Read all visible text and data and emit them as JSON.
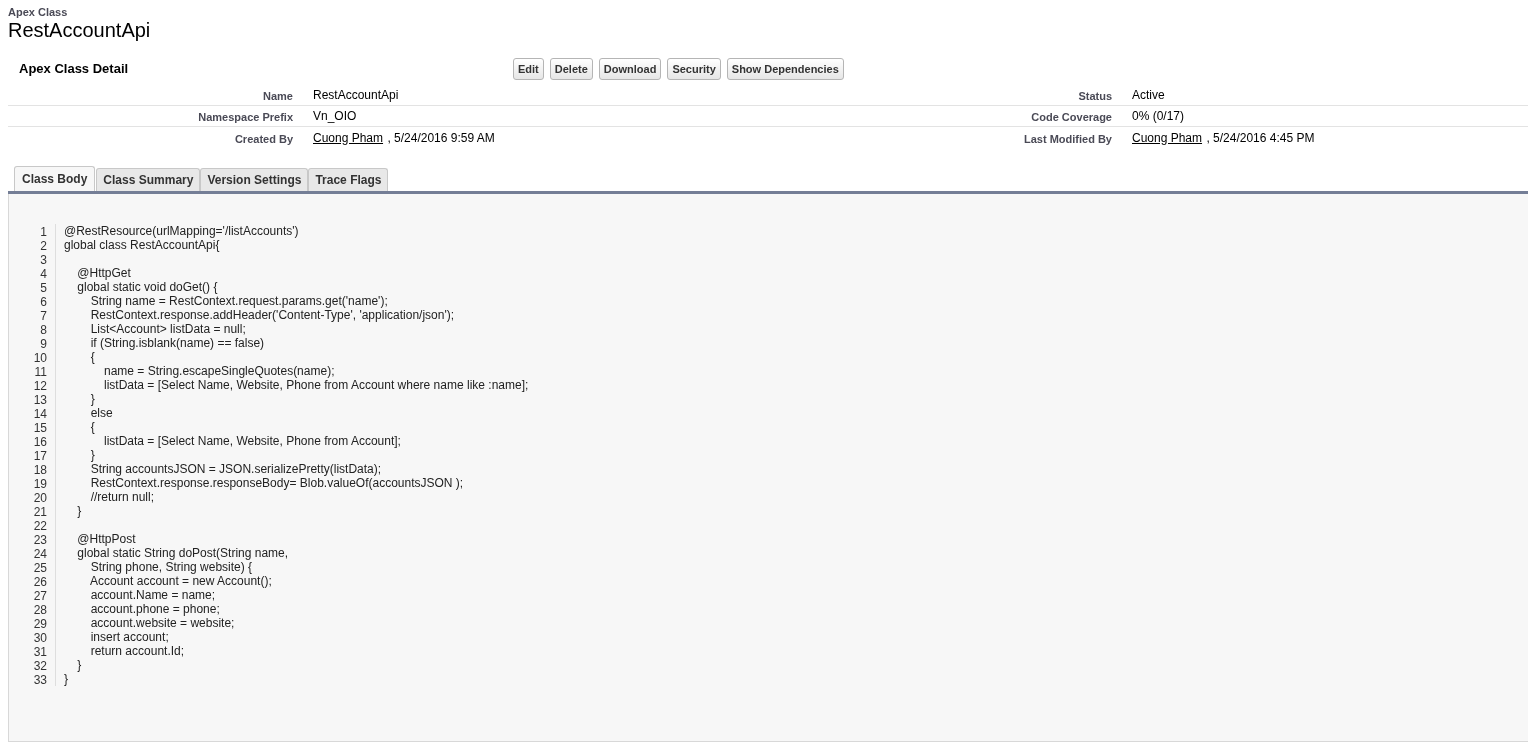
{
  "header": {
    "object_type": "Apex Class",
    "title": "RestAccountApi"
  },
  "detail": {
    "heading": "Apex Class Detail",
    "buttons": [
      "Edit",
      "Delete",
      "Download",
      "Security",
      "Show Dependencies"
    ],
    "rows": [
      {
        "left": {
          "label": "Name",
          "kind": "text",
          "value": "RestAccountApi"
        },
        "right": {
          "label": "Status",
          "kind": "text",
          "value": "Active"
        }
      },
      {
        "left": {
          "label": "Namespace Prefix",
          "kind": "text",
          "value": "Vn_OIO"
        },
        "right": {
          "label": "Code Coverage",
          "kind": "text",
          "value": "0% (0/17)"
        }
      },
      {
        "left": {
          "label": "Created By",
          "kind": "user",
          "user": "Cuong Pham",
          "date": ", 5/24/2016 9:59 AM"
        },
        "right": {
          "label": "Last Modified By",
          "kind": "user",
          "user": "Cuong Pham",
          "date": ", 5/24/2016 4:45 PM"
        }
      }
    ]
  },
  "tabs": [
    {
      "label": "Class Body",
      "selected": true
    },
    {
      "label": "Class Summary",
      "selected": false
    },
    {
      "label": "Version Settings",
      "selected": false
    },
    {
      "label": "Trace Flags",
      "selected": false
    }
  ],
  "code": [
    {
      "number": "1",
      "text": "@RestResource(urlMapping='/listAccounts')"
    },
    {
      "number": "2",
      "text": "global class RestAccountApi{"
    },
    {
      "number": "3"
    },
    {
      "number": "4",
      "text": "    @HttpGet"
    },
    {
      "number": "5",
      "text": "    global static void doGet() {"
    },
    {
      "number": "6",
      "text": "        String name = RestContext.request.params.get('name');"
    },
    {
      "number": "7",
      "text": "        RestContext.response.addHeader('Content-Type', 'application/json');"
    },
    {
      "number": "8",
      "text": "        List<Account> listData = null;"
    },
    {
      "number": "9",
      "text": "        if (String.isblank(name) == false)"
    },
    {
      "number": "10",
      "text": "        {"
    },
    {
      "number": "11",
      "text": "            name = String.escapeSingleQuotes(name);"
    },
    {
      "number": "12",
      "text": "            listData = [Select Name, Website, Phone from Account where name like :name];"
    },
    {
      "number": "13",
      "text": "        }"
    },
    {
      "number": "14",
      "text": "        else"
    },
    {
      "number": "15",
      "text": "        {"
    },
    {
      "number": "16",
      "text": "            listData = [Select Name, Website, Phone from Account];"
    },
    {
      "number": "17",
      "text": "        }"
    },
    {
      "number": "18",
      "text": "        String accountsJSON = JSON.serializePretty(listData);"
    },
    {
      "number": "19",
      "text": "        RestContext.response.responseBody= Blob.valueOf(accountsJSON );"
    },
    {
      "number": "20",
      "text": "        //return null;"
    },
    {
      "number": "21",
      "text": "    }"
    },
    {
      "number": "22"
    },
    {
      "number": "23",
      "text": "    @HttpPost"
    },
    {
      "number": "24",
      "text": "    global static String doPost(String name,"
    },
    {
      "number": "25",
      "text": "        String phone, String website) {"
    },
    {
      "number": "26",
      "text": "        Account account = new Account();"
    },
    {
      "number": "27",
      "text": "        account.Name = name;"
    },
    {
      "number": "28",
      "text": "        account.phone = phone;"
    },
    {
      "number": "29",
      "text": "        account.website = website;"
    },
    {
      "number": "30",
      "text": "        insert account;"
    },
    {
      "number": "31",
      "text": "        return account.Id;"
    },
    {
      "number": "32",
      "text": "    }"
    },
    {
      "number": "33",
      "text": "}"
    }
  ]
}
